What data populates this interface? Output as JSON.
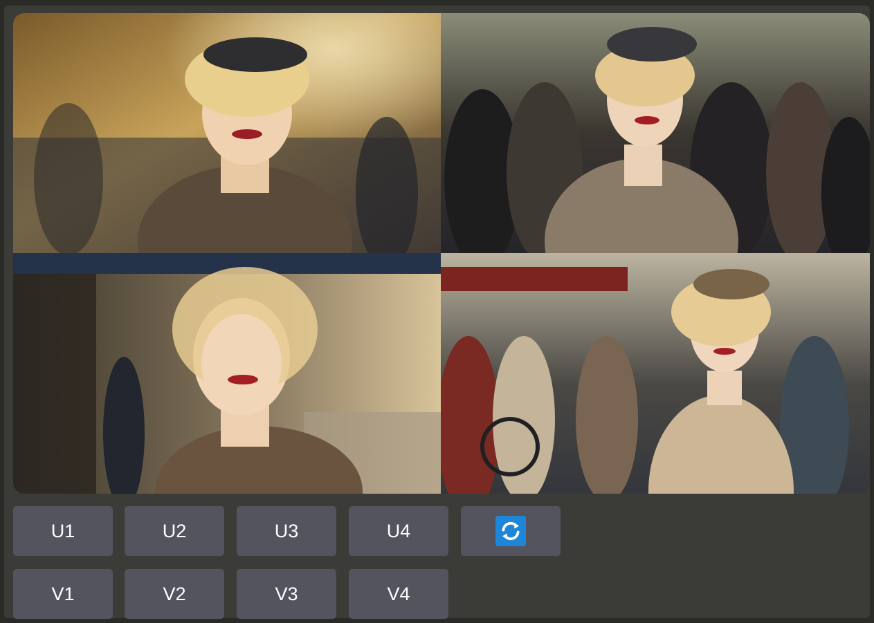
{
  "grid": {
    "images": [
      {
        "name": "upper-left"
      },
      {
        "name": "upper-right"
      },
      {
        "name": "lower-left"
      },
      {
        "name": "lower-right"
      }
    ]
  },
  "upscale_buttons": [
    {
      "label": "U1"
    },
    {
      "label": "U2"
    },
    {
      "label": "U3"
    },
    {
      "label": "U4"
    }
  ],
  "variation_buttons": [
    {
      "label": "V1"
    },
    {
      "label": "V2"
    },
    {
      "label": "V3"
    },
    {
      "label": "V4"
    }
  ],
  "reroll_button": {
    "icon": "refresh-icon"
  },
  "colors": {
    "button_bg": "#54545f",
    "background": "#3b3b38",
    "refresh_accent": "#1e86d8"
  }
}
